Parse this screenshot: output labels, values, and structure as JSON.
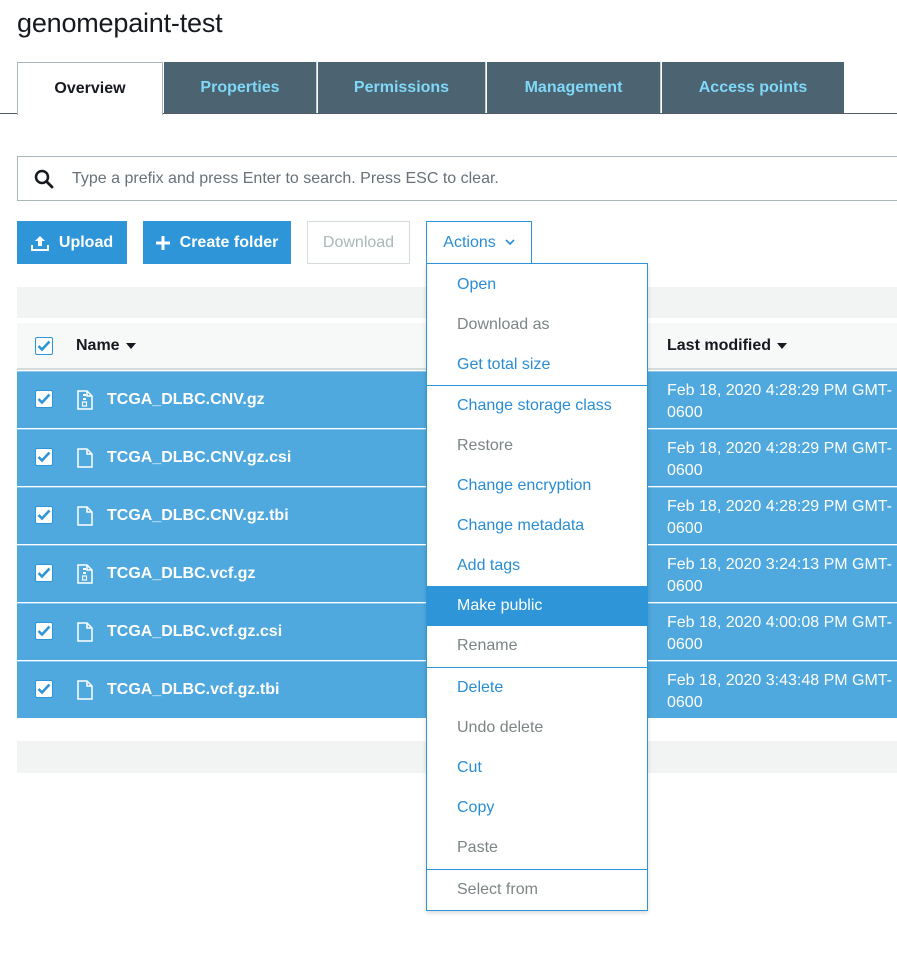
{
  "bucket": {
    "title": "genomepaint-test"
  },
  "tabs": [
    {
      "label": "Overview",
      "active": true
    },
    {
      "label": "Properties",
      "active": false
    },
    {
      "label": "Permissions",
      "active": false
    },
    {
      "label": "Management",
      "active": false
    },
    {
      "label": "Access points",
      "active": false
    }
  ],
  "search": {
    "placeholder": "Type a prefix and press Enter to search. Press ESC to clear.",
    "value": ""
  },
  "toolbar": {
    "upload_label": "Upload",
    "create_folder_label": "Create folder",
    "download_label": "Download",
    "actions_label": "Actions"
  },
  "table": {
    "headers": {
      "name": "Name",
      "last_modified": "Last modified"
    },
    "rows": [
      {
        "name": "TCGA_DLBC.CNV.gz",
        "icon": "archive-file-icon",
        "modified": "Feb 18, 2020 4:28:29 PM GMT-0600",
        "checked": true
      },
      {
        "name": "TCGA_DLBC.CNV.gz.csi",
        "icon": "file-icon",
        "modified": "Feb 18, 2020 4:28:29 PM GMT-0600",
        "checked": true
      },
      {
        "name": "TCGA_DLBC.CNV.gz.tbi",
        "icon": "file-icon",
        "modified": "Feb 18, 2020 4:28:29 PM GMT-0600",
        "checked": true
      },
      {
        "name": "TCGA_DLBC.vcf.gz",
        "icon": "archive-file-icon",
        "modified": "Feb 18, 2020 3:24:13 PM GMT-0600",
        "checked": true
      },
      {
        "name": "TCGA_DLBC.vcf.gz.csi",
        "icon": "file-icon",
        "modified": "Feb 18, 2020 4:00:08 PM GMT-0600",
        "checked": true
      },
      {
        "name": "TCGA_DLBC.vcf.gz.tbi",
        "icon": "file-icon",
        "modified": "Feb 18, 2020 3:43:48 PM GMT-0600",
        "checked": true
      }
    ]
  },
  "actions_menu": {
    "items": [
      {
        "label": "Open",
        "state": "enabled"
      },
      {
        "label": "Download as",
        "state": "disabled"
      },
      {
        "label": "Get total size",
        "state": "enabled"
      },
      {
        "label": "Change storage class",
        "state": "enabled"
      },
      {
        "label": "Restore",
        "state": "disabled"
      },
      {
        "label": "Change encryption",
        "state": "enabled"
      },
      {
        "label": "Change metadata",
        "state": "enabled"
      },
      {
        "label": "Add tags",
        "state": "enabled"
      },
      {
        "label": "Make public",
        "state": "hover"
      },
      {
        "label": "Rename",
        "state": "disabled"
      },
      {
        "label": "Delete",
        "state": "enabled"
      },
      {
        "label": "Undo delete",
        "state": "disabled"
      },
      {
        "label": "Cut",
        "state": "enabled"
      },
      {
        "label": "Copy",
        "state": "enabled"
      },
      {
        "label": "Paste",
        "state": "disabled"
      },
      {
        "label": "Select from",
        "state": "disabled"
      }
    ]
  },
  "colors": {
    "accent": "#2e96d8",
    "tab_bg": "#4c6372",
    "tab_text": "#7fd8f7",
    "selected_row": "#4fa8de"
  }
}
